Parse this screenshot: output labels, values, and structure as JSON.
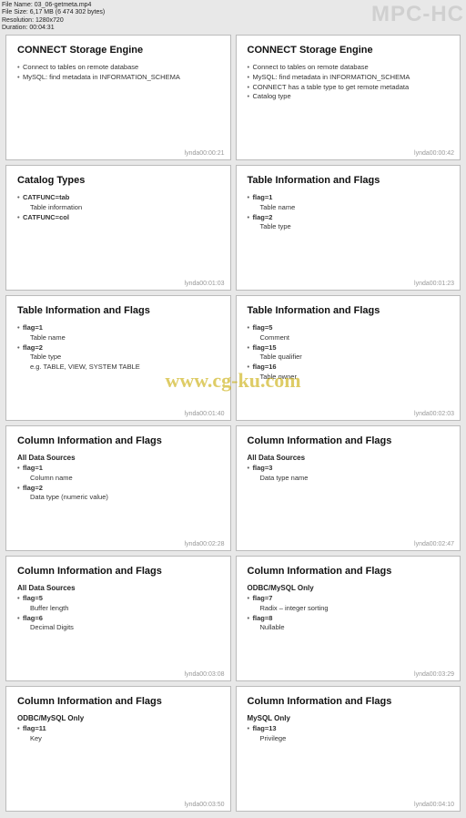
{
  "meta": {
    "filename_label": "File Name: 03_06-getmeta.mp4",
    "filesize_label": "File Size: 6,17 MB (6 474 302 bytes)",
    "resolution_label": "Resolution: 1280x720",
    "duration_label": "Duration: 00:04:31"
  },
  "app_title": "MPC-HC",
  "watermark": "www.cg-ku.com",
  "slides": [
    {
      "title": "CONNECT Storage Engine",
      "items": [
        {
          "text": "Connect to tables on remote database"
        },
        {
          "text": "MySQL: find metadata in INFORMATION_SCHEMA"
        }
      ],
      "ts": "lynda00:00:21"
    },
    {
      "title": "CONNECT Storage Engine",
      "items": [
        {
          "text": "Connect to tables on remote database"
        },
        {
          "text": "MySQL: find metadata in INFORMATION_SCHEMA"
        },
        {
          "text": "CONNECT has a table type to get remote metadata"
        },
        {
          "text": "Catalog type"
        }
      ],
      "ts": "lynda00:00:42"
    },
    {
      "title": "Catalog Types",
      "items": [
        {
          "text": "CATFUNC=tab",
          "bold": true
        },
        {
          "text": "Table information",
          "sub": true
        },
        {
          "text": "CATFUNC=col",
          "bold": true
        }
      ],
      "ts": "lynda00:01:03"
    },
    {
      "title": "Table Information and Flags",
      "items": [
        {
          "text": "flag=1",
          "bold": true
        },
        {
          "text": "Table name",
          "sub": true
        },
        {
          "text": "flag=2",
          "bold": true
        },
        {
          "text": "Table type",
          "sub": true
        }
      ],
      "ts": "lynda00:01:23"
    },
    {
      "title": "Table Information and Flags",
      "items": [
        {
          "text": "flag=1",
          "bold": true
        },
        {
          "text": "Table name",
          "sub": true
        },
        {
          "text": "flag=2",
          "bold": true
        },
        {
          "text": "Table type",
          "sub": true
        },
        {
          "text": "e.g. TABLE, VIEW, SYSTEM TABLE",
          "sub": true
        }
      ],
      "ts": "lynda00:01:40"
    },
    {
      "title": "Table Information and Flags",
      "items": [
        {
          "text": "flag=5",
          "bold": true
        },
        {
          "text": "Comment",
          "sub": true
        },
        {
          "text": "flag=15",
          "bold": true
        },
        {
          "text": "Table qualifier",
          "sub": true
        },
        {
          "text": "flag=16",
          "bold": true
        },
        {
          "text": "Table owner",
          "sub": true
        }
      ],
      "ts": "lynda00:02:03"
    },
    {
      "title": "Column Information and Flags",
      "subtitle": "All Data Sources",
      "items": [
        {
          "text": "flag=1",
          "bold": true
        },
        {
          "text": "Column name",
          "sub": true
        },
        {
          "text": "flag=2",
          "bold": true
        },
        {
          "text": "Data type (numeric value)",
          "sub": true
        }
      ],
      "ts": "lynda00:02:28"
    },
    {
      "title": "Column Information and Flags",
      "subtitle": "All Data Sources",
      "items": [
        {
          "text": "flag=3",
          "bold": true
        },
        {
          "text": "Data type name",
          "sub": true
        }
      ],
      "ts": "lynda00:02:47"
    },
    {
      "title": "Column Information and Flags",
      "subtitle": "All Data Sources",
      "items": [
        {
          "text": "flag=5",
          "bold": true
        },
        {
          "text": "Buffer length",
          "sub": true
        },
        {
          "text": "flag=6",
          "bold": true
        },
        {
          "text": "Decimal Digits",
          "sub": true
        }
      ],
      "ts": "lynda00:03:08"
    },
    {
      "title": "Column Information and Flags",
      "subtitle": "ODBC/MySQL Only",
      "items": [
        {
          "text": "flag=7",
          "bold": true
        },
        {
          "text": "Radix – integer sorting",
          "sub": true
        },
        {
          "text": "flag=8",
          "bold": true
        },
        {
          "text": "Nullable",
          "sub": true
        }
      ],
      "ts": "lynda00:03:29"
    },
    {
      "title": "Column Information and Flags",
      "subtitle": "ODBC/MySQL Only",
      "items": [
        {
          "text": "flag=11",
          "bold": true
        },
        {
          "text": "Key",
          "sub": true
        }
      ],
      "ts": "lynda00:03:50"
    },
    {
      "title": "Column Information and Flags",
      "subtitle": "MySQL Only",
      "items": [
        {
          "text": "flag=13",
          "bold": true
        },
        {
          "text": "Privilege",
          "sub": true
        }
      ],
      "ts": "lynda00:04:10"
    }
  ]
}
